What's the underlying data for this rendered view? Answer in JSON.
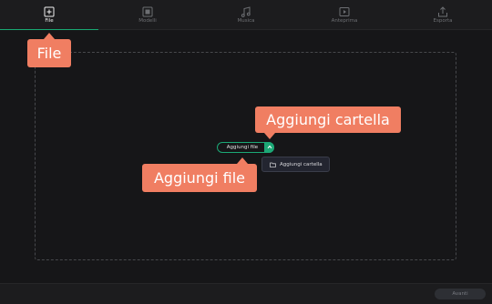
{
  "tabs": [
    {
      "label": "File",
      "icon": "file-plus-icon",
      "active": true
    },
    {
      "label": "Modelli",
      "icon": "template-icon",
      "active": false
    },
    {
      "label": "Musica",
      "icon": "music-note-icon",
      "active": false
    },
    {
      "label": "Anteprima",
      "icon": "play-preview-icon",
      "active": false
    },
    {
      "label": "Esporta",
      "icon": "export-icon",
      "active": false
    }
  ],
  "main": {
    "add_file_label": "Aggiungi file",
    "dropdown_item_label": "Aggiungi cartella"
  },
  "callouts": {
    "file": "File",
    "add_folder": "Aggiungi cartella",
    "add_file": "Aggiungi file"
  },
  "footer": {
    "next_label": "Avanti"
  },
  "colors": {
    "accent": "#19a974",
    "callout": "#f07e62",
    "background": "#161618"
  }
}
